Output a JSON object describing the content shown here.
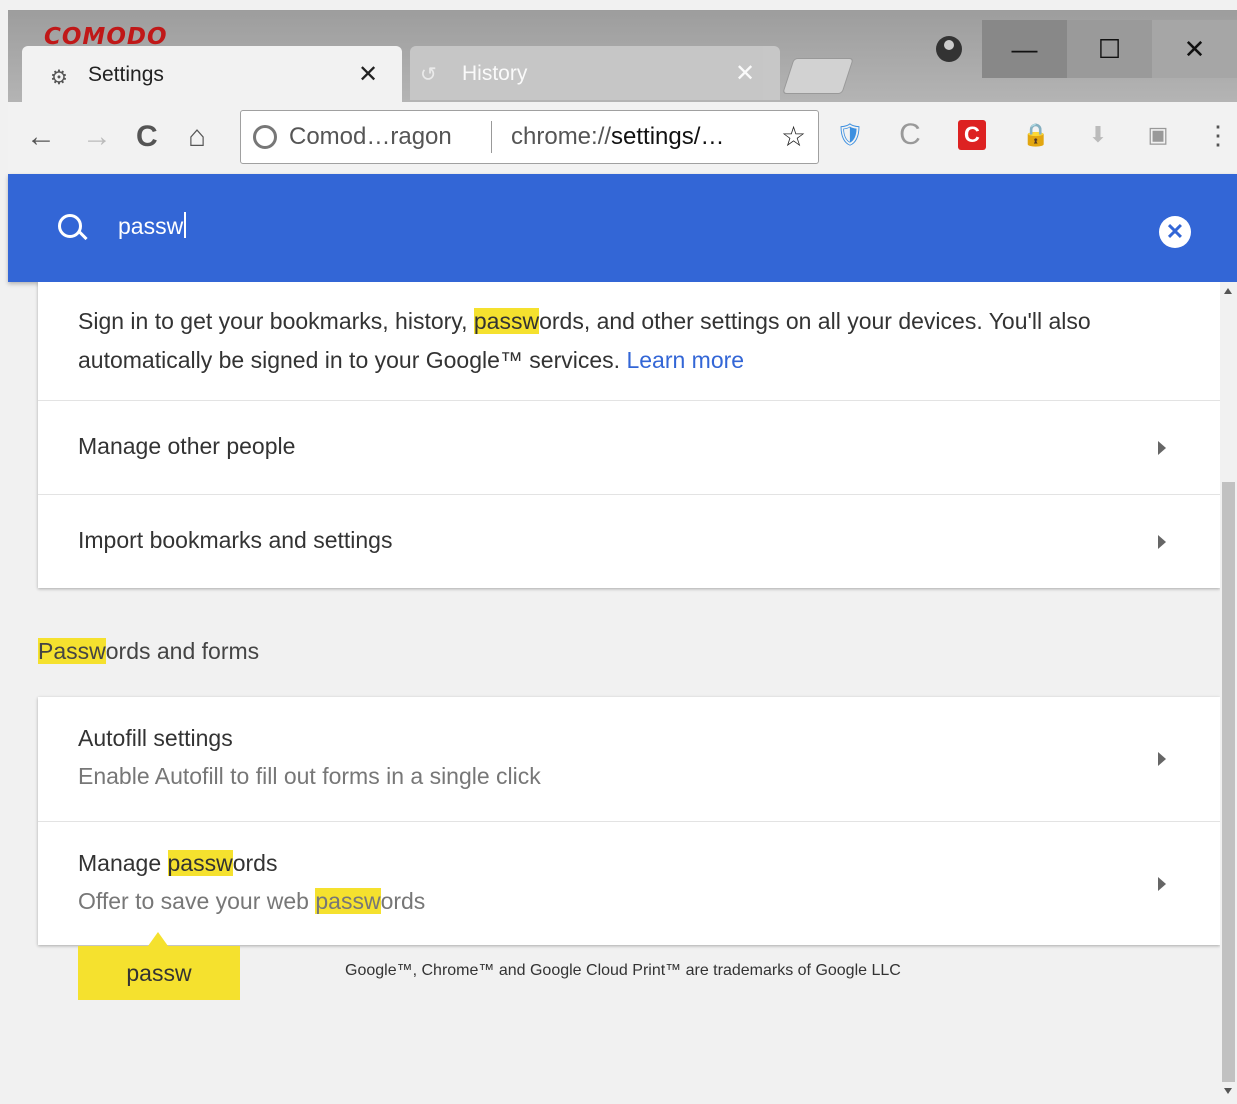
{
  "window": {
    "brand": "COMODO",
    "minimize_glyph": "—",
    "maximize_glyph": "☐",
    "close_glyph": "✕"
  },
  "tabs": [
    {
      "label": "Settings",
      "icon": "gear-icon",
      "close": "✕",
      "active": true
    },
    {
      "label": "History",
      "icon": "history-icon",
      "close": "✕",
      "active": false
    }
  ],
  "toolbar": {
    "back": "←",
    "forward": "→",
    "reload": "C",
    "home": "⌂",
    "site_name": "Comod…ragon",
    "url_prefix": "chrome://",
    "url_main": "settings/…",
    "star": "☆",
    "menu": "⋮"
  },
  "search": {
    "value": "passw",
    "clear": "✕"
  },
  "people_card": {
    "signin_pre": "Sign in to get your bookmarks, history, ",
    "signin_hl": "passw",
    "signin_post": "ords, and other settings on all your devices. You'll also automatically be signed in to your Google™ services.",
    "learn_more": "Learn more",
    "rows": [
      {
        "title": "Manage other people"
      },
      {
        "title": "Import bookmarks and settings"
      }
    ]
  },
  "section": {
    "title_hl": "Passw",
    "title_rest": "ords and forms"
  },
  "forms_card": {
    "autofill_title": "Autofill settings",
    "autofill_sub": "Enable Autofill to fill out forms in a single click",
    "manage_title_pre": "Manage ",
    "manage_title_hl": "passw",
    "manage_title_post": "ords",
    "manage_sub_pre": "Offer to save your web ",
    "manage_sub_hl": "passw",
    "manage_sub_post": "ords"
  },
  "bubble": "passw",
  "footer": "Google™, Chrome™ and Google Cloud Print™ are trademarks of Google LLC",
  "colors": {
    "header": "#3366d6",
    "highlight": "#f5e12e",
    "link": "#3366d6",
    "brand": "#c01818"
  }
}
